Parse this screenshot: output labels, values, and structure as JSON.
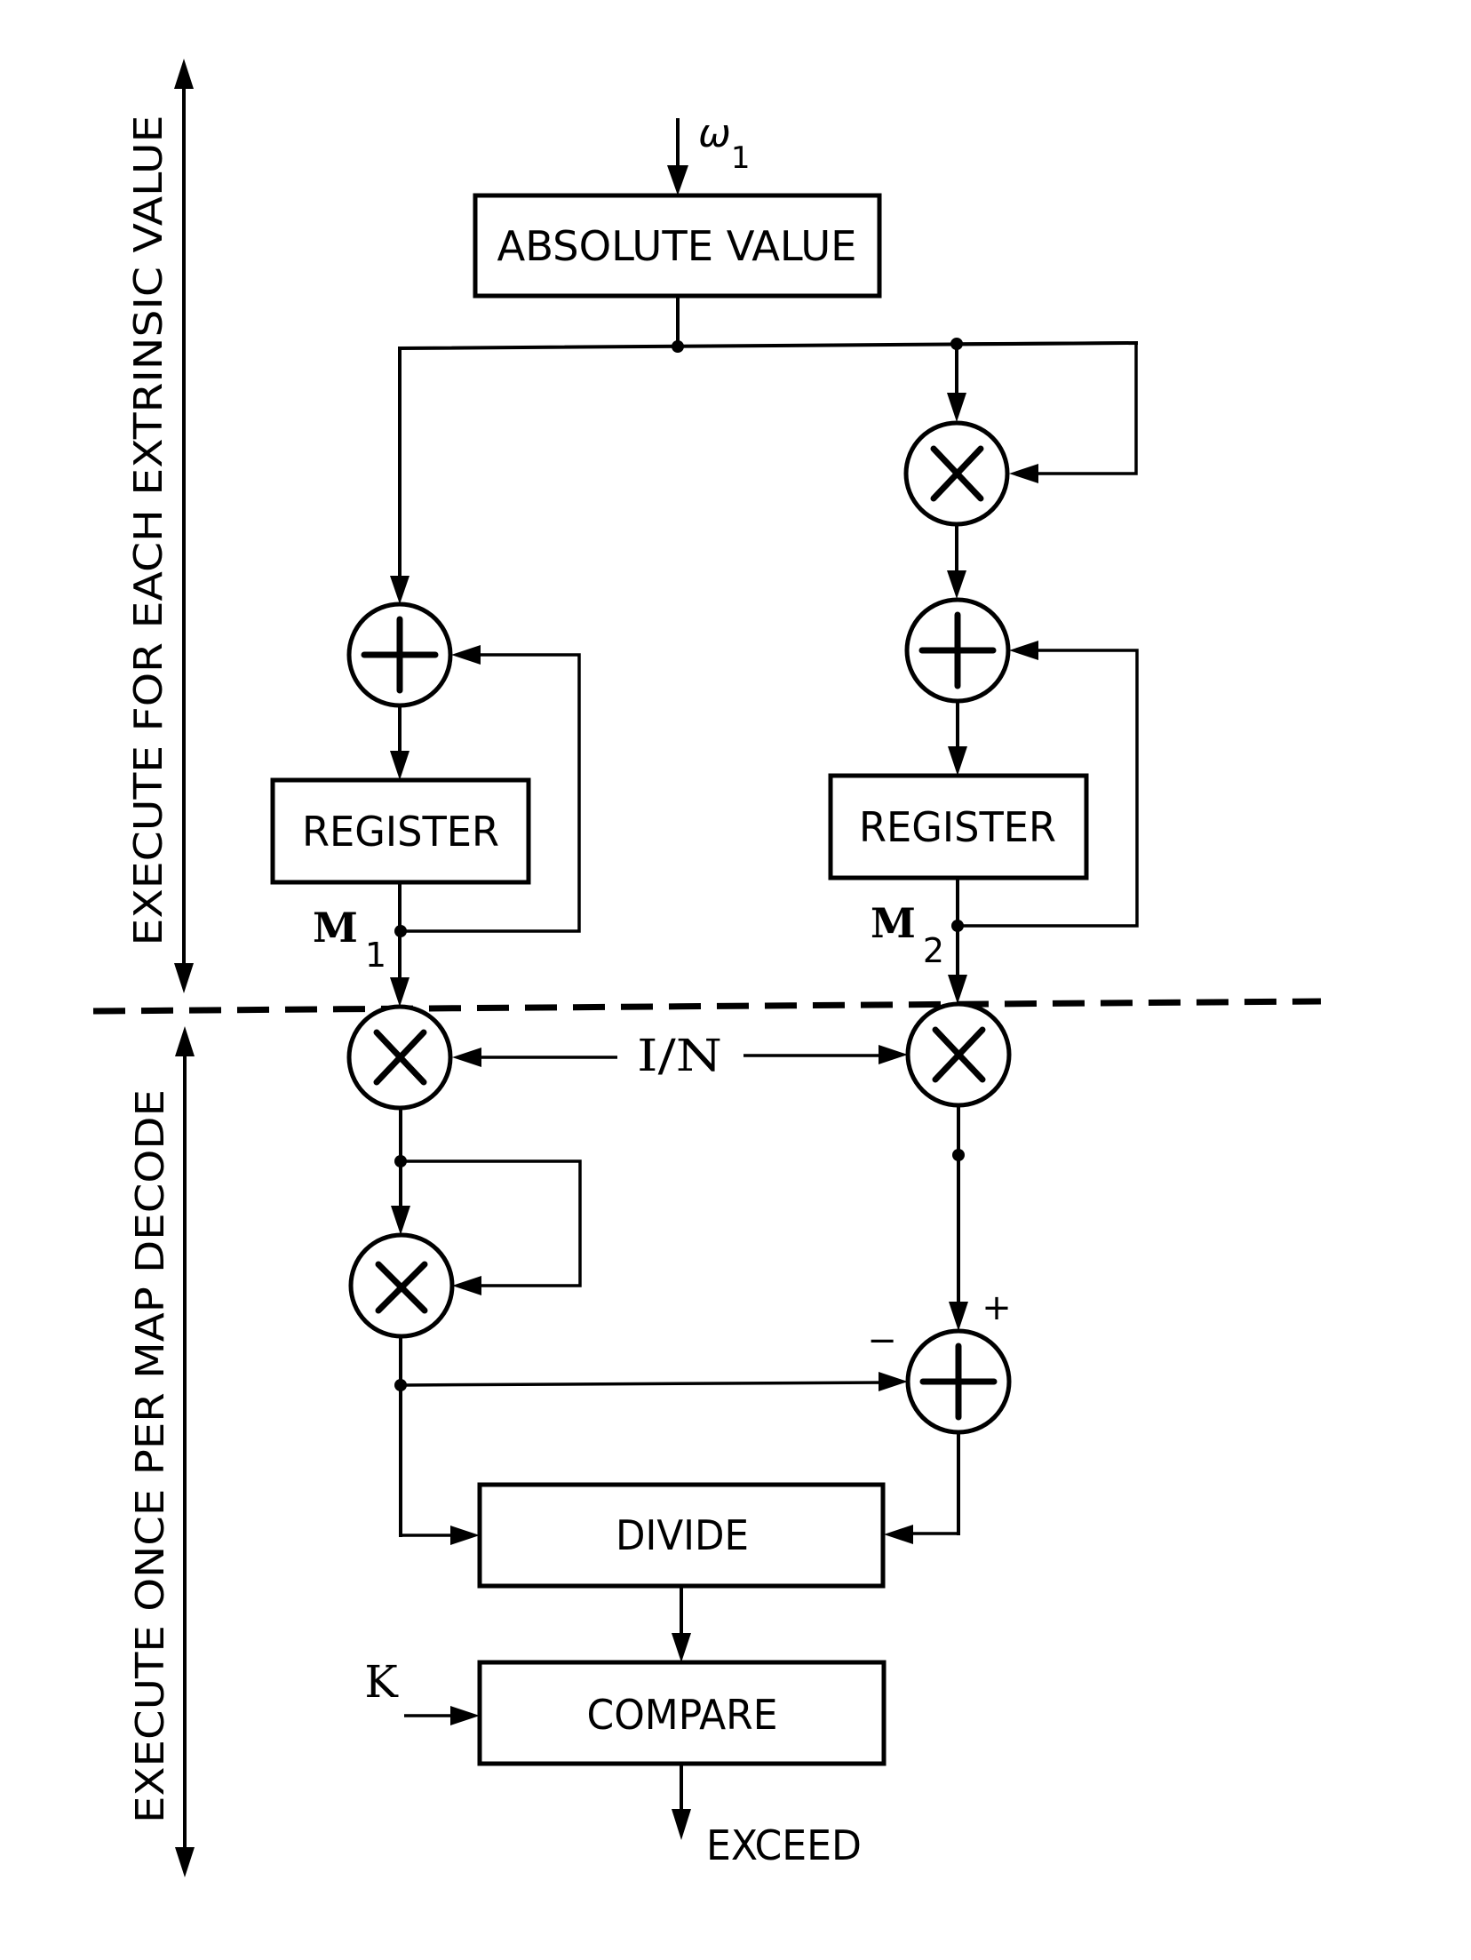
{
  "figure": {
    "type": "block-diagram",
    "phases": {
      "upper": "EXECUTE FOR EACH EXTRINSIC VALUE",
      "lower": "EXECUTE ONCE PER MAP DECODE"
    },
    "input": {
      "symbol": "ω",
      "subscript": "1"
    },
    "blocks": {
      "absolute_value": "ABSOLUTE VALUE",
      "register_1": "REGISTER",
      "register_2": "REGISTER",
      "divide": "DIVIDE",
      "compare": "COMPARE"
    },
    "operators": {
      "multiply": "×",
      "add": "+"
    },
    "signals": {
      "m1": {
        "symbol": "M",
        "subscript": "1"
      },
      "m2": {
        "symbol": "M",
        "subscript": "2"
      },
      "scale": "I/N",
      "threshold": "K",
      "output": "EXCEED",
      "plus_sign": "+",
      "minus_sign": "−"
    }
  }
}
